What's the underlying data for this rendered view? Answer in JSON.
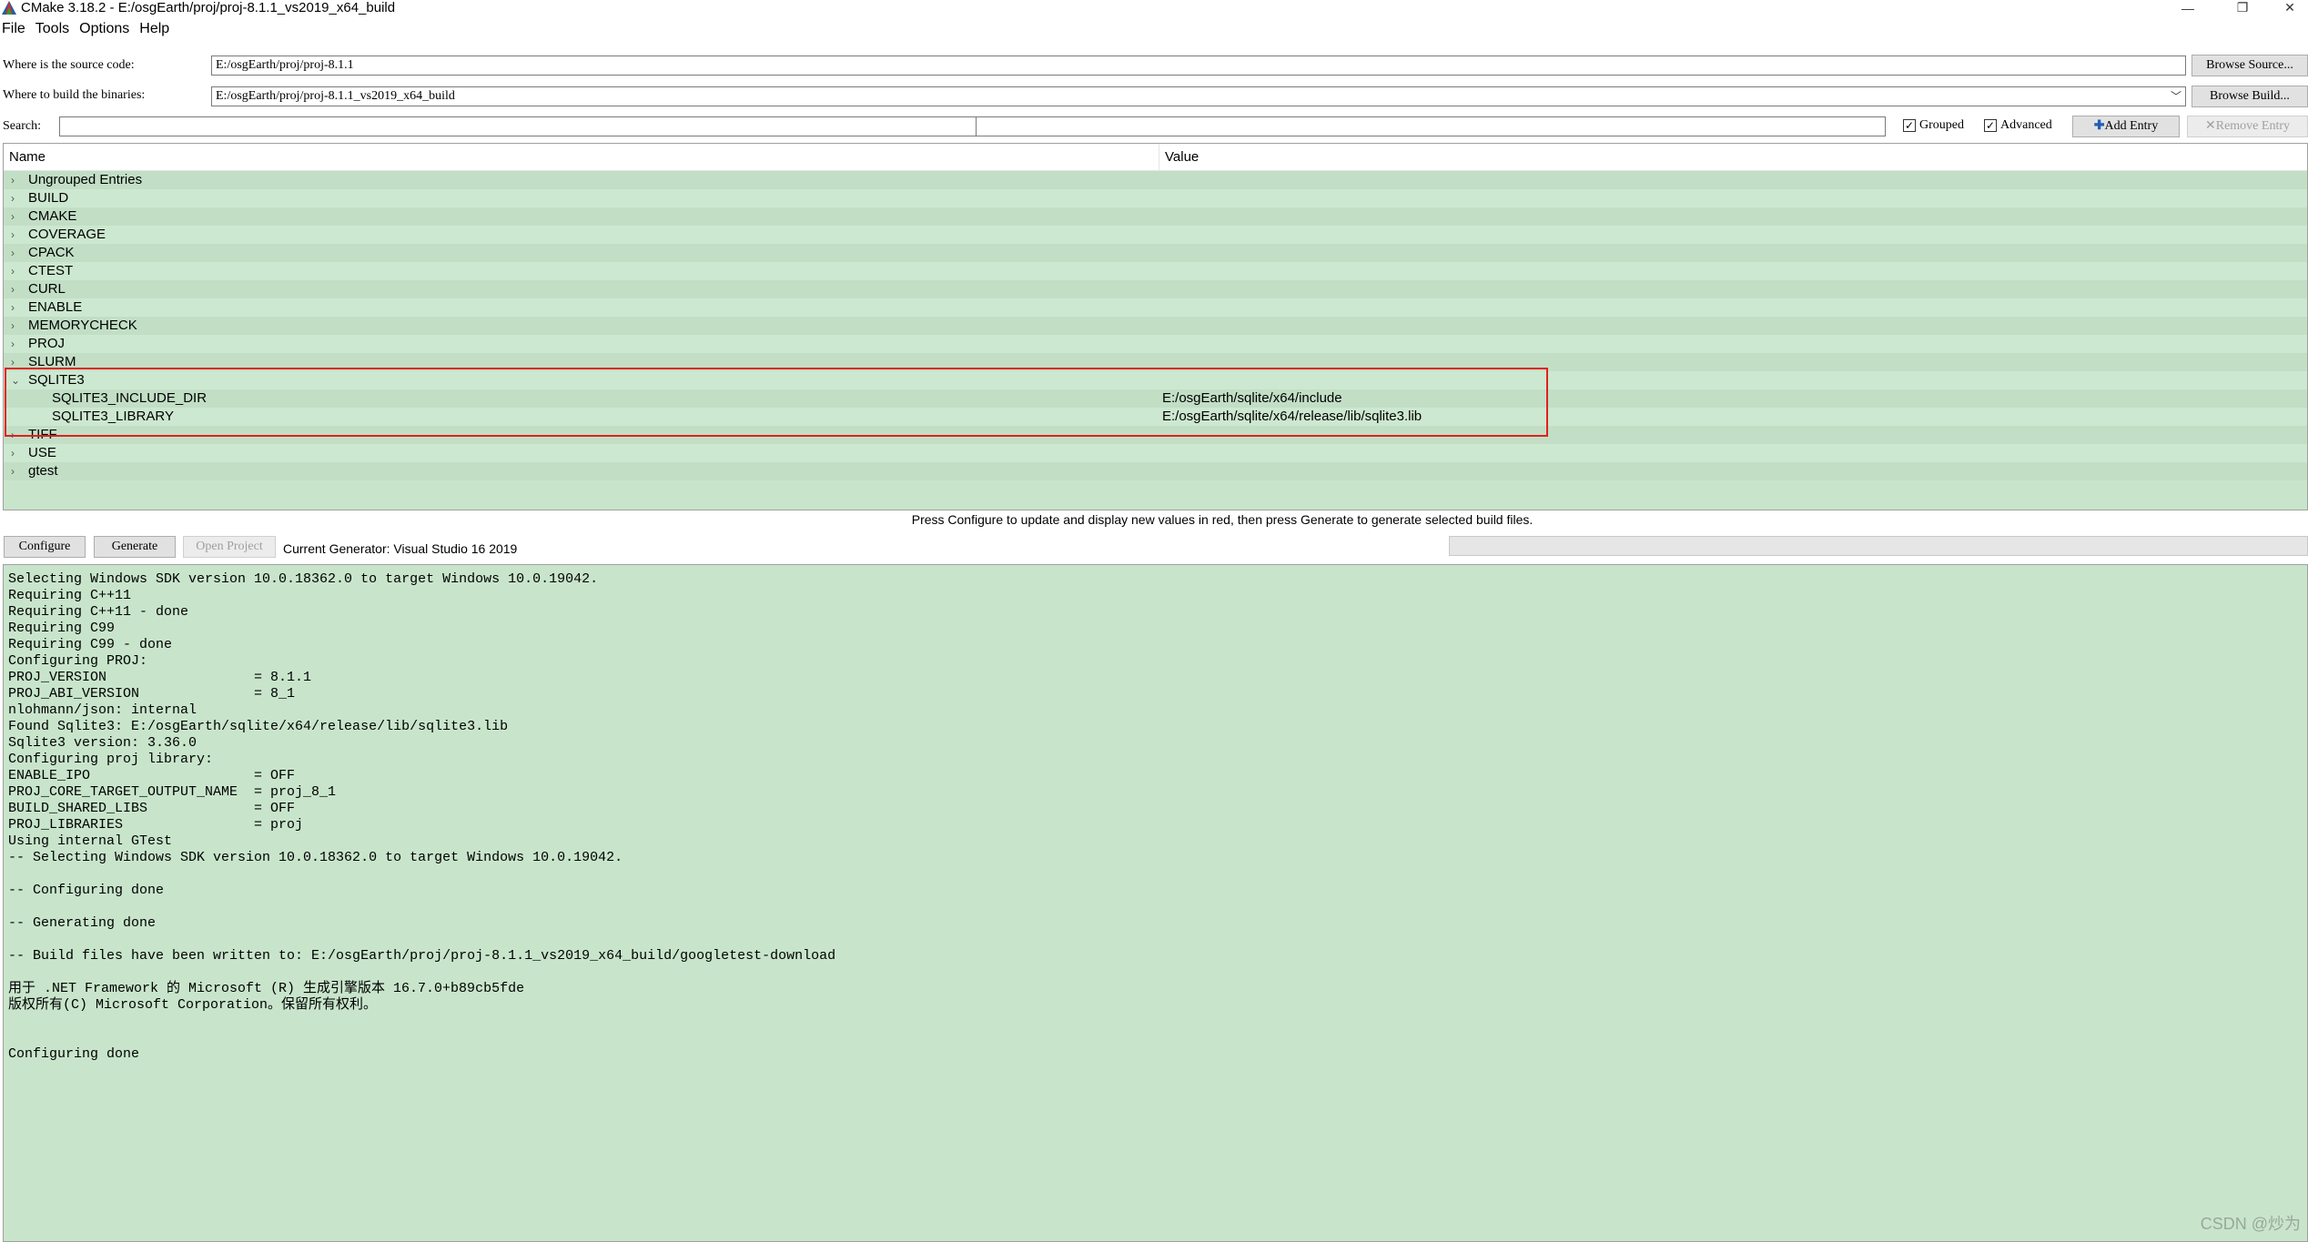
{
  "window": {
    "title": "CMake 3.18.2 - E:/osgEarth/proj/proj-8.1.1_vs2019_x64_build",
    "minimize_glyph": "—",
    "maximize_glyph": "❐",
    "close_glyph": "✕"
  },
  "menu": [
    "File",
    "Tools",
    "Options",
    "Help"
  ],
  "source": {
    "label": "Where is the source code:",
    "value": "E:/osgEarth/proj/proj-8.1.1",
    "browse_label": "Browse Source..."
  },
  "build": {
    "label": "Where to build the binaries:",
    "value": "E:/osgEarth/proj/proj-8.1.1_vs2019_x64_build",
    "browse_label": "Browse Build..."
  },
  "search": {
    "label": "Search:",
    "value": ""
  },
  "options": {
    "grouped_label": "Grouped",
    "grouped_checked": true,
    "advanced_label": "Advanced",
    "advanced_checked": true,
    "add_entry_label": "Add Entry",
    "remove_entry_label": "Remove Entry"
  },
  "tree": {
    "columns": {
      "name": "Name",
      "value": "Value"
    },
    "groups": [
      {
        "name": "Ungrouped Entries",
        "expanded": false
      },
      {
        "name": "BUILD",
        "expanded": false
      },
      {
        "name": "CMAKE",
        "expanded": false
      },
      {
        "name": "COVERAGE",
        "expanded": false
      },
      {
        "name": "CPACK",
        "expanded": false
      },
      {
        "name": "CTEST",
        "expanded": false
      },
      {
        "name": "CURL",
        "expanded": false
      },
      {
        "name": "ENABLE",
        "expanded": false
      },
      {
        "name": "MEMORYCHECK",
        "expanded": false
      },
      {
        "name": "PROJ",
        "expanded": false
      },
      {
        "name": "SLURM",
        "expanded": false
      },
      {
        "name": "SQLITE3",
        "expanded": true,
        "children": [
          {
            "name": "SQLITE3_INCLUDE_DIR",
            "value": "E:/osgEarth/sqlite/x64/include"
          },
          {
            "name": "SQLITE3_LIBRARY",
            "value": "E:/osgEarth/sqlite/x64/release/lib/sqlite3.lib"
          }
        ]
      },
      {
        "name": "TIFF",
        "expanded": false
      },
      {
        "name": "USE",
        "expanded": false
      },
      {
        "name": "gtest",
        "expanded": false
      }
    ]
  },
  "status": {
    "hint": "Press Configure to update and display new values in red, then press Generate to generate selected build files.",
    "configure_label": "Configure",
    "generate_label": "Generate",
    "open_project_label": "Open Project",
    "generator_text": "Current Generator: Visual Studio 16 2019"
  },
  "log": [
    "Selecting Windows SDK version 10.0.18362.0 to target Windows 10.0.19042.",
    "Requiring C++11",
    "Requiring C++11 - done",
    "Requiring C99",
    "Requiring C99 - done",
    "Configuring PROJ:",
    "PROJ_VERSION                  = 8.1.1",
    "PROJ_ABI_VERSION              = 8_1",
    "nlohmann/json: internal",
    "Found Sqlite3: E:/osgEarth/sqlite/x64/release/lib/sqlite3.lib",
    "Sqlite3 version: 3.36.0",
    "Configuring proj library:",
    "ENABLE_IPO                    = OFF",
    "PROJ_CORE_TARGET_OUTPUT_NAME  = proj_8_1",
    "BUILD_SHARED_LIBS             = OFF",
    "PROJ_LIBRARIES                = proj",
    "Using internal GTest",
    "-- Selecting Windows SDK version 10.0.18362.0 to target Windows 10.0.19042.",
    "",
    "-- Configuring done",
    "",
    "-- Generating done",
    "",
    "-- Build files have been written to: E:/osgEarth/proj/proj-8.1.1_vs2019_x64_build/googletest-download",
    "",
    "用于 .NET Framework 的 Microsoft (R) 生成引擎版本 16.7.0+b89cb5fde",
    "版权所有(C) Microsoft Corporation。保留所有权利。",
    "",
    "",
    "Configuring done"
  ],
  "watermark": "CSDN @炒为"
}
